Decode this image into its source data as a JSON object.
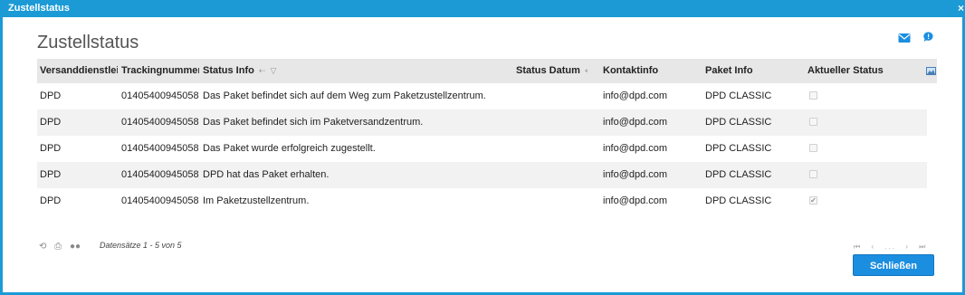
{
  "window": {
    "title": "Zustellstatus",
    "close_glyph": "×"
  },
  "page": {
    "heading": "Zustellstatus"
  },
  "colors": {
    "accent": "#1b9ad6",
    "button": "#1b8ee0",
    "header_bg": "#e7e7e7",
    "row_alt": "#f2f2f2"
  },
  "columns": {
    "carrier": "Versanddienstleister",
    "tracking": "Trackingnummer",
    "status_info": "Status Info",
    "status_date": "Status Datum",
    "contact": "Kontaktinfo",
    "package": "Paket Info",
    "current": "Aktueller Status"
  },
  "icons": {
    "mail": "mail-icon",
    "chat": "chat-icon",
    "column_chooser": "column-chooser-icon",
    "refresh": "refresh-icon",
    "print": "print-icon",
    "settings": "settings-icon"
  },
  "rows": [
    {
      "carrier": "DPD",
      "tracking": "01405400945058",
      "status_info": "Das Paket befindet sich auf dem Weg zum Paketzustellzentrum.",
      "status_date": "",
      "contact": "info@dpd.com",
      "package": "DPD CLASSIC",
      "current": false
    },
    {
      "carrier": "DPD",
      "tracking": "01405400945058",
      "status_info": "Das Paket befindet sich im Paketversandzentrum.",
      "status_date": "",
      "contact": "info@dpd.com",
      "package": "DPD CLASSIC",
      "current": false
    },
    {
      "carrier": "DPD",
      "tracking": "01405400945058",
      "status_info": "Das Paket wurde erfolgreich zugestellt.",
      "status_date": "",
      "contact": "info@dpd.com",
      "package": "DPD CLASSIC",
      "current": false
    },
    {
      "carrier": "DPD",
      "tracking": "01405400945058",
      "status_info": "DPD hat das Paket erhalten.",
      "status_date": "",
      "contact": "info@dpd.com",
      "package": "DPD CLASSIC",
      "current": false
    },
    {
      "carrier": "DPD",
      "tracking": "01405400945058",
      "status_info": "Im Paketzustellzentrum.",
      "status_date": "",
      "contact": "info@dpd.com",
      "package": "DPD CLASSIC",
      "current": true
    }
  ],
  "footer": {
    "records": "Datensätze 1 - 5 von 5",
    "pager": {
      "first": "⏮",
      "prev": "‹",
      "ellipsis": "...",
      "next": "›",
      "last": "⏭"
    },
    "close_button": "Schließen"
  }
}
